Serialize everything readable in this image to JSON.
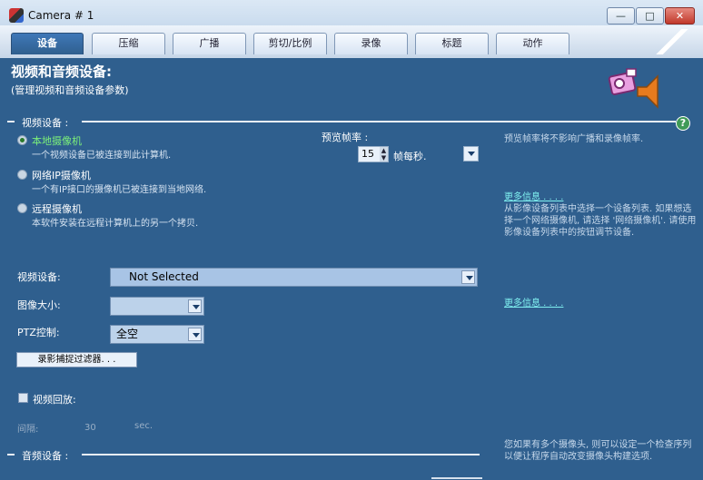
{
  "window": {
    "title": "Camera # 1"
  },
  "tabs": [
    {
      "label": "设备",
      "active": true
    },
    {
      "label": "压缩",
      "active": false
    },
    {
      "label": "广播",
      "active": false
    },
    {
      "label": "剪切/比例",
      "active": false
    },
    {
      "label": "录像",
      "active": false
    },
    {
      "label": "标题",
      "active": false
    },
    {
      "label": "动作",
      "active": false
    }
  ],
  "header": {
    "title": "视频和音频设备:",
    "subtitle": "(管理视频和音频设备参数)"
  },
  "video_section": {
    "label": "视频设备 :",
    "options": [
      {
        "title": "本地摄像机",
        "desc": "一个视频设备已被连接到此计算机.",
        "checked": true
      },
      {
        "title": "网络IP摄像机",
        "desc": "一个有IP接口的摄像机已被连接到当地网络.",
        "checked": false
      },
      {
        "title": "远程摄像机",
        "desc": "本软件安装在远程计算机上的另一个拷贝.",
        "checked": false
      }
    ],
    "preview_rate": {
      "label": "预览帧率 :",
      "value": "15",
      "unit": "帧每秒."
    },
    "info_preview": "预览帧率将不影响广播和录像帧率.",
    "more_info_1": "更多信息 . . . .",
    "info_select": "从影像设备列表中选择一个设备列表. 如果想选择一个网络摄像机, 请选择 '网络摄像机'. 请使用影像设备列表中的按钮调节设备.",
    "more_info_2": "更多信息 . . . .",
    "video_device": {
      "label": "视频设备:",
      "value": "Not Selected"
    },
    "image_size": {
      "label": "图像大小:",
      "value": ""
    },
    "ptz": {
      "label": "PTZ控制:",
      "value": "全空"
    },
    "capture_filter_button": "录影捕捉过滤器. . .",
    "video_playback": {
      "label": "视频回放:",
      "checked": false
    },
    "interval": {
      "label": "间隔:",
      "value": "30",
      "unit": "sec."
    },
    "info_multi": "您如果有多个摄像头, 则可以设定一个检查序列以便让程序自动改变摄像头构建选项."
  },
  "audio_section": {
    "label": "音频设备 :"
  },
  "colors": {
    "background": "#2f5f8e",
    "link": "#7ff0f0",
    "selected": "#7cf07a"
  }
}
